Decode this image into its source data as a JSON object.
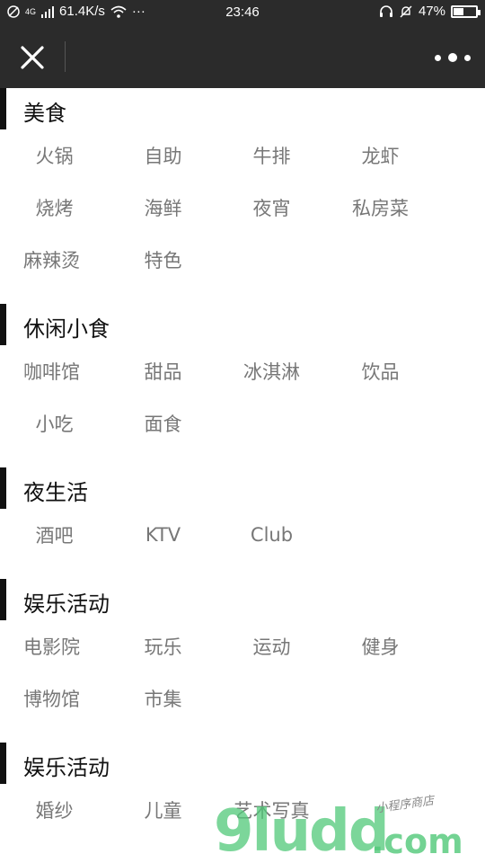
{
  "status_bar": {
    "network": "4G",
    "speed": "61.4K/s",
    "more": "···",
    "time": "23:46",
    "battery": "47%",
    "battery_level": 0.47
  },
  "sections": [
    {
      "title": "美食",
      "items": [
        "火锅",
        "自助",
        "牛排",
        "龙虾",
        "烧烤",
        "海鲜",
        "夜宵",
        "私房菜",
        "麻辣烫",
        "特色"
      ]
    },
    {
      "title": "休闲小食",
      "items": [
        "咖啡馆",
        "甜品",
        "冰淇淋",
        "饮品",
        "小吃",
        "面食"
      ]
    },
    {
      "title": "夜生活",
      "items": [
        "酒吧",
        "KTV",
        "Club"
      ]
    },
    {
      "title": "娱乐活动",
      "items": [
        "电影院",
        "玩乐",
        "运动",
        "健身",
        "博物馆",
        "市集"
      ]
    },
    {
      "title": "娱乐活动",
      "items": [
        "婚纱",
        "儿童",
        "艺术写真"
      ]
    }
  ],
  "watermark": {
    "main": "9ludd",
    "domain": ".com",
    "tagline": "小程序商店"
  }
}
